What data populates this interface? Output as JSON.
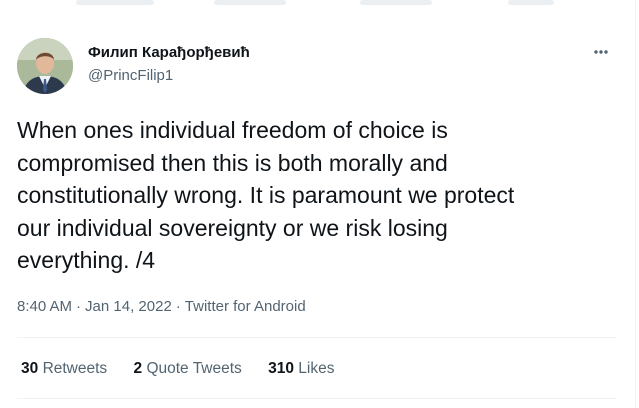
{
  "author": {
    "display_name": "Филип Карађорђевић",
    "handle": "@PrincFilip1"
  },
  "tweet": {
    "text": "When ones individual freedom of choice is\ncompromised then this is both morally and\nconstitutionally wrong. It is paramount we protect\nour individual sovereignty or we risk losing\neverything. /4",
    "time": "8:40 AM",
    "separator": "·",
    "date": "Jan 14, 2022",
    "source": "Twitter for Android"
  },
  "stats": {
    "retweets_count": "30",
    "retweets_label": "Retweets",
    "quotes_count": "2",
    "quotes_label": "Quote Tweets",
    "likes_count": "310",
    "likes_label": "Likes"
  },
  "icons": {
    "more": "more-horizontal-icon",
    "avatar": "avatar-photo"
  },
  "colors": {
    "text": "#0f1419",
    "secondary": "#536471",
    "divider": "#eff3f4"
  }
}
